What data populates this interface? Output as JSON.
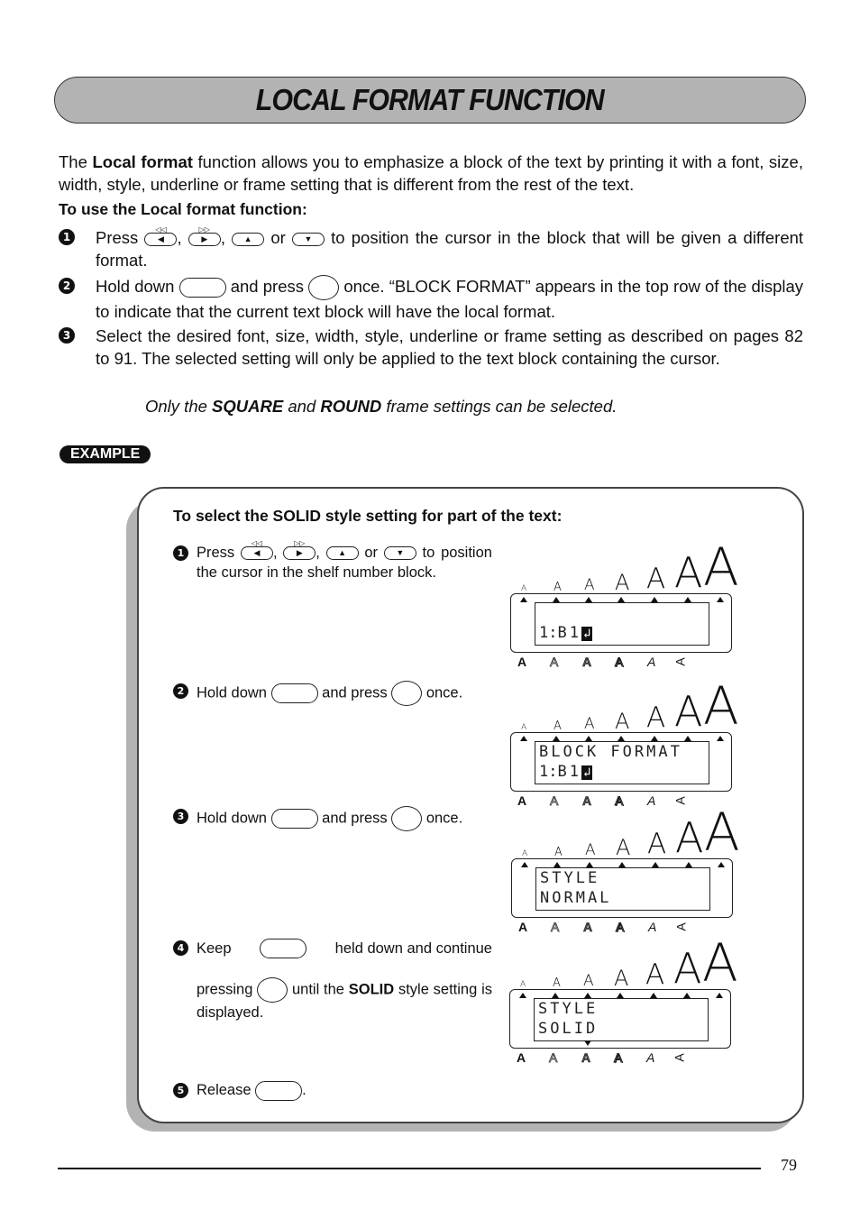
{
  "page": {
    "title": "LOCAL FORMAT FUNCTION",
    "intro_prefix": "The ",
    "intro_bold": "Local format",
    "intro_rest": " function allows you to emphasize a block of the text by printing it with a font, size, width, style, underline or frame setting that is different from the rest of the text.",
    "subheading": "To use the Local format function:",
    "steps": [
      {
        "num": "1",
        "parts": [
          "Press",
          ",",
          ",",
          "or",
          "to position the cursor in the block that will be given a different format."
        ]
      },
      {
        "num": "2",
        "parts": [
          "Hold down",
          "and press",
          "once. “BLOCK FORMAT” appears in the top row of the display to indicate that the current text block will have the local format."
        ]
      },
      {
        "num": "3",
        "text": "Select the desired font, size, width, style, underline or frame setting as described on pages 82 to 91. The selected setting will only be applied to the text block containing the cursor."
      }
    ],
    "note": {
      "pre": "Only the ",
      "b1": "SQUARE",
      "mid": " and ",
      "b2": "ROUND",
      "post": " frame settings can be selected."
    },
    "example_badge": "EXAMPLE",
    "page_number": "79"
  },
  "keys": {
    "left_top": "◁◁",
    "left": "◀",
    "right_top": "▷▷",
    "right": "▶",
    "up": "▲",
    "down": "▼"
  },
  "example": {
    "heading": "To select the SOLID style setting for part of the text:",
    "steps": [
      {
        "num": "1",
        "parts": [
          "Press",
          ",",
          ",",
          "or",
          "to",
          "position the cursor in the shelf number block."
        ]
      },
      {
        "num": "2",
        "parts": [
          "Hold down",
          "and press",
          "once."
        ]
      },
      {
        "num": "3",
        "parts": [
          "Hold down",
          "and press",
          "once."
        ]
      },
      {
        "num": "4",
        "parts": [
          "Keep",
          "held down and continue",
          "pressing",
          "until the ",
          "SOLID",
          " style setting is displayed."
        ]
      },
      {
        "num": "5",
        "parts": [
          "Release",
          "."
        ]
      }
    ],
    "size_glyph": "A",
    "style_glyphs": [
      "A",
      "A",
      "A",
      "A",
      "A",
      "A"
    ],
    "displays": [
      {
        "line1": "",
        "line2_prefix": "1:",
        "line2_text": "B1",
        "cursor": "↲"
      },
      {
        "line1": "BLOCK FORMAT",
        "line2_prefix": "1:",
        "line2_text": "B1",
        "cursor": "↲"
      },
      {
        "line1": "STYLE",
        "line2_prefix": "",
        "line2_text": "NORMAL",
        "cursor": ""
      },
      {
        "line1": "STYLE",
        "line2_prefix": "",
        "line2_text": "SOLID",
        "cursor": ""
      }
    ]
  }
}
